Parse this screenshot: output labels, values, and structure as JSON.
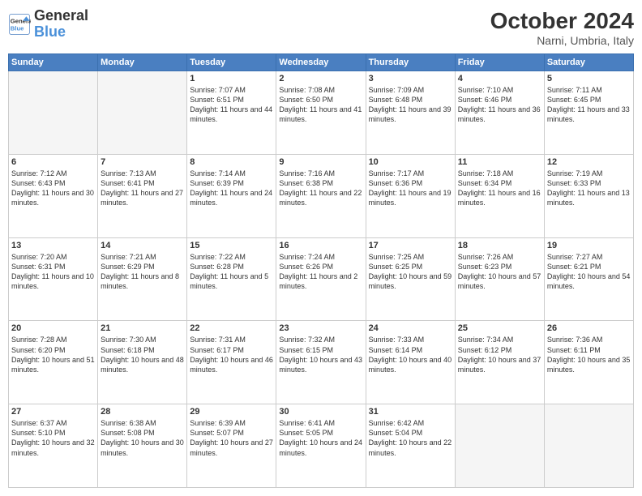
{
  "logo": {
    "line1": "General",
    "line2": "Blue"
  },
  "title": "October 2024",
  "subtitle": "Narni, Umbria, Italy",
  "days_of_week": [
    "Sunday",
    "Monday",
    "Tuesday",
    "Wednesday",
    "Thursday",
    "Friday",
    "Saturday"
  ],
  "weeks": [
    [
      {
        "day": "",
        "info": ""
      },
      {
        "day": "",
        "info": ""
      },
      {
        "day": "1",
        "info": "Sunrise: 7:07 AM\nSunset: 6:51 PM\nDaylight: 11 hours and 44 minutes."
      },
      {
        "day": "2",
        "info": "Sunrise: 7:08 AM\nSunset: 6:50 PM\nDaylight: 11 hours and 41 minutes."
      },
      {
        "day": "3",
        "info": "Sunrise: 7:09 AM\nSunset: 6:48 PM\nDaylight: 11 hours and 39 minutes."
      },
      {
        "day": "4",
        "info": "Sunrise: 7:10 AM\nSunset: 6:46 PM\nDaylight: 11 hours and 36 minutes."
      },
      {
        "day": "5",
        "info": "Sunrise: 7:11 AM\nSunset: 6:45 PM\nDaylight: 11 hours and 33 minutes."
      }
    ],
    [
      {
        "day": "6",
        "info": "Sunrise: 7:12 AM\nSunset: 6:43 PM\nDaylight: 11 hours and 30 minutes."
      },
      {
        "day": "7",
        "info": "Sunrise: 7:13 AM\nSunset: 6:41 PM\nDaylight: 11 hours and 27 minutes."
      },
      {
        "day": "8",
        "info": "Sunrise: 7:14 AM\nSunset: 6:39 PM\nDaylight: 11 hours and 24 minutes."
      },
      {
        "day": "9",
        "info": "Sunrise: 7:16 AM\nSunset: 6:38 PM\nDaylight: 11 hours and 22 minutes."
      },
      {
        "day": "10",
        "info": "Sunrise: 7:17 AM\nSunset: 6:36 PM\nDaylight: 11 hours and 19 minutes."
      },
      {
        "day": "11",
        "info": "Sunrise: 7:18 AM\nSunset: 6:34 PM\nDaylight: 11 hours and 16 minutes."
      },
      {
        "day": "12",
        "info": "Sunrise: 7:19 AM\nSunset: 6:33 PM\nDaylight: 11 hours and 13 minutes."
      }
    ],
    [
      {
        "day": "13",
        "info": "Sunrise: 7:20 AM\nSunset: 6:31 PM\nDaylight: 11 hours and 10 minutes."
      },
      {
        "day": "14",
        "info": "Sunrise: 7:21 AM\nSunset: 6:29 PM\nDaylight: 11 hours and 8 minutes."
      },
      {
        "day": "15",
        "info": "Sunrise: 7:22 AM\nSunset: 6:28 PM\nDaylight: 11 hours and 5 minutes."
      },
      {
        "day": "16",
        "info": "Sunrise: 7:24 AM\nSunset: 6:26 PM\nDaylight: 11 hours and 2 minutes."
      },
      {
        "day": "17",
        "info": "Sunrise: 7:25 AM\nSunset: 6:25 PM\nDaylight: 10 hours and 59 minutes."
      },
      {
        "day": "18",
        "info": "Sunrise: 7:26 AM\nSunset: 6:23 PM\nDaylight: 10 hours and 57 minutes."
      },
      {
        "day": "19",
        "info": "Sunrise: 7:27 AM\nSunset: 6:21 PM\nDaylight: 10 hours and 54 minutes."
      }
    ],
    [
      {
        "day": "20",
        "info": "Sunrise: 7:28 AM\nSunset: 6:20 PM\nDaylight: 10 hours and 51 minutes."
      },
      {
        "day": "21",
        "info": "Sunrise: 7:30 AM\nSunset: 6:18 PM\nDaylight: 10 hours and 48 minutes."
      },
      {
        "day": "22",
        "info": "Sunrise: 7:31 AM\nSunset: 6:17 PM\nDaylight: 10 hours and 46 minutes."
      },
      {
        "day": "23",
        "info": "Sunrise: 7:32 AM\nSunset: 6:15 PM\nDaylight: 10 hours and 43 minutes."
      },
      {
        "day": "24",
        "info": "Sunrise: 7:33 AM\nSunset: 6:14 PM\nDaylight: 10 hours and 40 minutes."
      },
      {
        "day": "25",
        "info": "Sunrise: 7:34 AM\nSunset: 6:12 PM\nDaylight: 10 hours and 37 minutes."
      },
      {
        "day": "26",
        "info": "Sunrise: 7:36 AM\nSunset: 6:11 PM\nDaylight: 10 hours and 35 minutes."
      }
    ],
    [
      {
        "day": "27",
        "info": "Sunrise: 6:37 AM\nSunset: 5:10 PM\nDaylight: 10 hours and 32 minutes."
      },
      {
        "day": "28",
        "info": "Sunrise: 6:38 AM\nSunset: 5:08 PM\nDaylight: 10 hours and 30 minutes."
      },
      {
        "day": "29",
        "info": "Sunrise: 6:39 AM\nSunset: 5:07 PM\nDaylight: 10 hours and 27 minutes."
      },
      {
        "day": "30",
        "info": "Sunrise: 6:41 AM\nSunset: 5:05 PM\nDaylight: 10 hours and 24 minutes."
      },
      {
        "day": "31",
        "info": "Sunrise: 6:42 AM\nSunset: 5:04 PM\nDaylight: 10 hours and 22 minutes."
      },
      {
        "day": "",
        "info": ""
      },
      {
        "day": "",
        "info": ""
      }
    ]
  ]
}
